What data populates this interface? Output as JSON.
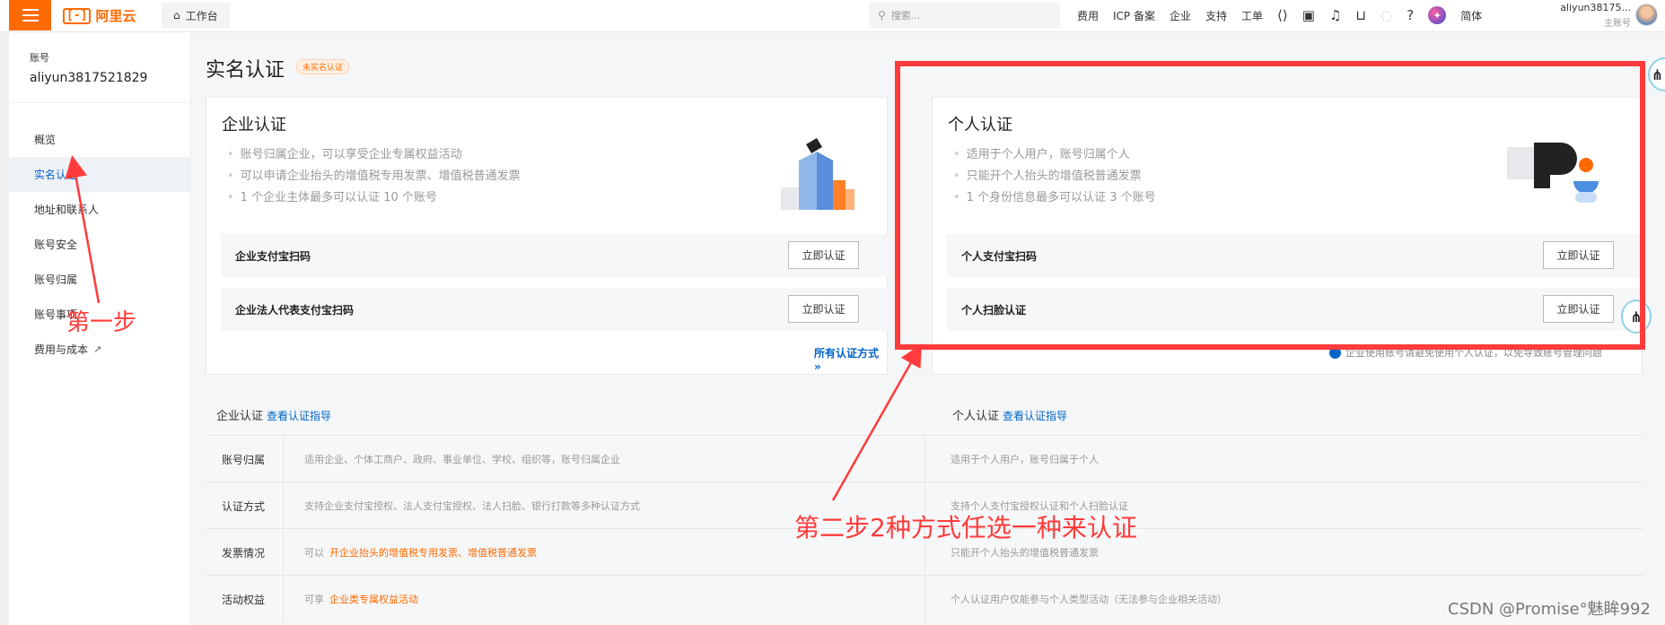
{
  "topbar": {
    "logo_text": "阿里云",
    "logo_mark": "[-]",
    "workbench": "工作台",
    "search_placeholder": "搜索...",
    "nav": [
      "费用",
      "ICP 备案",
      "企业",
      "支持",
      "工单"
    ],
    "lang": "简体",
    "username": "aliyun38175...",
    "role": "主账号"
  },
  "sidebar": {
    "label": "账号",
    "account": "aliyun3817521829",
    "items": [
      "概览",
      "实名认证",
      "地址和联系人",
      "账号安全",
      "账号归属",
      "账号事项",
      "费用与成本"
    ],
    "active_index": 1
  },
  "main": {
    "title": "实名认证",
    "badge": "未实名认证",
    "enterprise": {
      "title": "企业认证",
      "bullets": [
        "账号归属企业，可以享受企业专属权益活动",
        "可以申请企业抬头的增值税专用发票、增值税普通发票",
        "1 个企业主体最多可以认证 10 个账号"
      ],
      "options": [
        "企业支付宝扫码",
        "企业法人代表支付宝扫码"
      ],
      "button": "立即认证",
      "all_link": "所有认证方式 »"
    },
    "personal": {
      "title": "个人认证",
      "bullets": [
        "适用于个人用户，账号归属个人",
        "只能开个人抬头的增值税普通发票",
        "1 个身份信息最多可以认证 3 个账号"
      ],
      "options": [
        "个人支付宝扫码",
        "个人扫脸认证"
      ],
      "button": "立即认证",
      "note": "企业使用账号请避免使用个人认证，以免导致账号管理问题"
    }
  },
  "compare": {
    "ent_head": "企业认证",
    "per_head": "个人认证",
    "guide_link": "查看认证指导",
    "rows": [
      {
        "key": "账号归属",
        "ent": "适用企业、个体工商户、政府、事业单位、学校、组织等，账号归属企业",
        "ent_hl": "",
        "per": "适用于个人用户，账号归属于个人"
      },
      {
        "key": "认证方式",
        "ent": "支持企业支付宝授权、法人支付宝授权、法人扫脸、银行打款等多种认证方式",
        "ent_hl": "",
        "per": "支持个人支付宝授权认证和个人扫脸认证"
      },
      {
        "key": "发票情况",
        "ent": "可以",
        "ent_hl": "开企业抬头的增值税专用发票、增值税普通发票",
        "per": "只能开个人抬头的增值税普通发票"
      },
      {
        "key": "活动权益",
        "ent": "可享",
        "ent_hl": "企业类专属权益活动",
        "per": "个人认证用户仅能参与个人类型活动（无法参与企业相关活动）"
      }
    ]
  },
  "annotations": {
    "step1": "第一步",
    "step2": "第二步2种方式任选一种来认证",
    "watermark": "CSDN @Promise°魅眸992",
    "color": "#ff3b3b"
  }
}
